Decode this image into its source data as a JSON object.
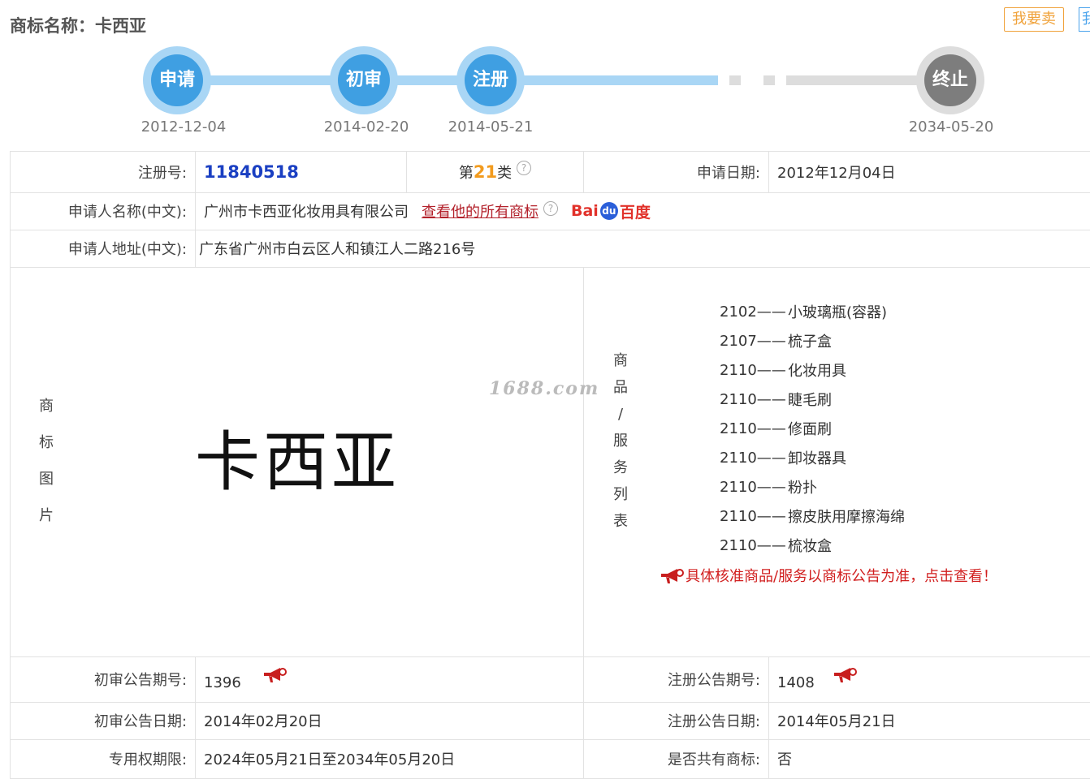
{
  "header": {
    "title": "商标名称：卡西亚",
    "sell_label": "我要卖",
    "sell2_label": "我"
  },
  "timeline": {
    "steps": [
      {
        "label": "申请",
        "date": "2012-12-04"
      },
      {
        "label": "初审",
        "date": "2014-02-20"
      },
      {
        "label": "注册",
        "date": "2014-05-21"
      },
      {
        "label": "终止",
        "date": "2034-05-20"
      }
    ]
  },
  "info": {
    "reg_no_label": "注册号:",
    "reg_no": "11840518",
    "class_prefix": "第",
    "class_num": "21",
    "class_suffix": "类",
    "apply_date_label": "申请日期:",
    "apply_date": "2012年12月04日",
    "applicant_label": "申请人名称(中文):",
    "applicant": "广州市卡西亚化妆用具有限公司",
    "all_marks_link": "查看他的所有商标",
    "baidu": {
      "part1": "Bai",
      "paw": "du",
      "part2": "百度"
    },
    "address_label": "申请人地址(中文):",
    "address": "广东省广州市白云区人和镇江人二路216号",
    "image_label_chars": [
      "商",
      "标",
      "图",
      "片"
    ],
    "mark_text": "卡西亚",
    "watermark": "1688.com",
    "goods_label_chars": [
      "商",
      "品",
      "/",
      "服",
      "务",
      "列",
      "表"
    ],
    "goods": [
      {
        "code": "2102——",
        "name": "小玻璃瓶(容器)"
      },
      {
        "code": "2107——",
        "name": "梳子盒"
      },
      {
        "code": "2110——",
        "name": "化妆用具"
      },
      {
        "code": "2110——",
        "name": "睫毛刷"
      },
      {
        "code": "2110——",
        "name": "修面刷"
      },
      {
        "code": "2110——",
        "name": "卸妆器具"
      },
      {
        "code": "2110——",
        "name": "粉扑"
      },
      {
        "code": "2110——",
        "name": "擦皮肤用摩擦海绵"
      },
      {
        "code": "2110——",
        "name": "梳妆盒"
      }
    ],
    "goods_notice": "具体核准商品/服务以商标公告为准，点击查看！",
    "prelim_no_label": "初审公告期号:",
    "prelim_no": "1396",
    "reg_pub_no_label": "注册公告期号:",
    "reg_pub_no": "1408",
    "prelim_date_label": "初审公告日期:",
    "prelim_date": "2014年02月20日",
    "reg_pub_date_label": "注册公告日期:",
    "reg_pub_date": "2014年05月21日",
    "term_label": "专用权期限:",
    "term": "2024年05月21日至2034年05月20日",
    "shared_label": "是否共有商标:",
    "shared": "否"
  },
  "colors": {
    "blue": "#3f9fe2",
    "light_blue": "#a9d6f5",
    "grey": "#7d7d7d",
    "red": "#d11f1f",
    "orange": "#f29b1e"
  }
}
